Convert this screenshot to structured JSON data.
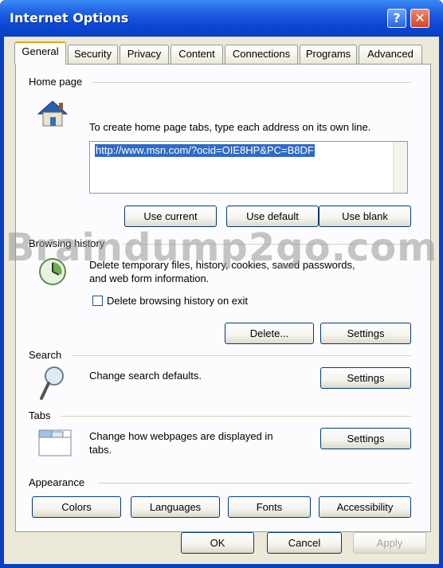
{
  "window": {
    "title": "Internet Options",
    "help_glyph": "?",
    "close_glyph": "✕",
    "title_color": "#0a3fc0"
  },
  "tabs": [
    {
      "label": "General",
      "active": true
    },
    {
      "label": "Security"
    },
    {
      "label": "Privacy"
    },
    {
      "label": "Content"
    },
    {
      "label": "Connections"
    },
    {
      "label": "Programs"
    },
    {
      "label": "Advanced"
    }
  ],
  "home_page": {
    "group_label": "Home page",
    "instruction": "To create home page tabs, type each address on its own line.",
    "url_value": "http://www.msn.com/?ocid=OIE8HP&PC=B8DF",
    "use_current": "Use current",
    "use_default": "Use default",
    "use_blank": "Use blank",
    "icon": "house-icon"
  },
  "browsing_history": {
    "group_label": "Browsing history",
    "description_line1": "Delete temporary files, history, cookies, saved passwords,",
    "description_line2": "and web form information.",
    "checkbox_label": "Delete browsing history on exit",
    "delete_button": "Delete...",
    "settings_button": "Settings",
    "icon": "clock-icon"
  },
  "search": {
    "group_label": "Search",
    "description": "Change search defaults.",
    "settings_button": "Settings",
    "icon": "magnifier-icon"
  },
  "tabs_group": {
    "group_label": "Tabs",
    "description_line1": "Change how webpages are displayed in",
    "description_line2": "tabs.",
    "settings_button": "Settings",
    "icon": "tabs-window-icon"
  },
  "appearance": {
    "group_label": "Appearance",
    "colors": "Colors",
    "languages": "Languages",
    "fonts": "Fonts",
    "accessibility": "Accessibility"
  },
  "footer": {
    "ok": "OK",
    "cancel": "Cancel",
    "apply": "Apply"
  },
  "watermark": "Braindump2go.com"
}
